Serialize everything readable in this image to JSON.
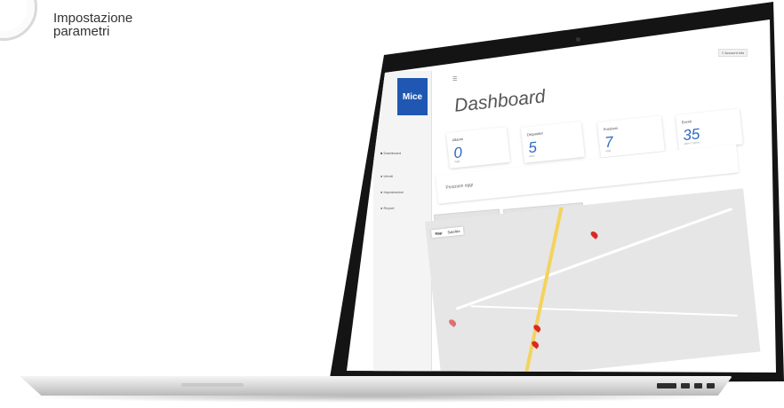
{
  "caption": {
    "line1": "Impostazione",
    "line2": "parametri"
  },
  "app": {
    "logo": "Mice"
  },
  "topbar": {
    "menu_icon": "menu-icon",
    "account_button": "≡ Account info"
  },
  "sidebar": {
    "items": [
      "■ Dashboard",
      "● Utenti",
      "● Impostazioni",
      "● Report"
    ]
  },
  "main": {
    "title": "Dashboard"
  },
  "cards": [
    {
      "label": "Allarmi",
      "value": "0",
      "sub": "oggi"
    },
    {
      "label": "Dispositivi",
      "value": "5",
      "sub": "attivi"
    },
    {
      "label": "Posizioni",
      "value": "7",
      "sub": "oggi"
    },
    {
      "label": "Eventi",
      "value": "35",
      "sub": "ultimi 7 giorni"
    }
  ],
  "panel": {
    "title": "Posizioni oggi"
  },
  "map": {
    "toggle_map": "Map",
    "toggle_sat": "Satellite",
    "tabs": [
      "Mappa",
      "Tabella"
    ]
  },
  "colors": {
    "brand": "#1f57b3",
    "value": "#2d6ac2",
    "pin": "#d92a22",
    "road": "#f4d35e"
  }
}
